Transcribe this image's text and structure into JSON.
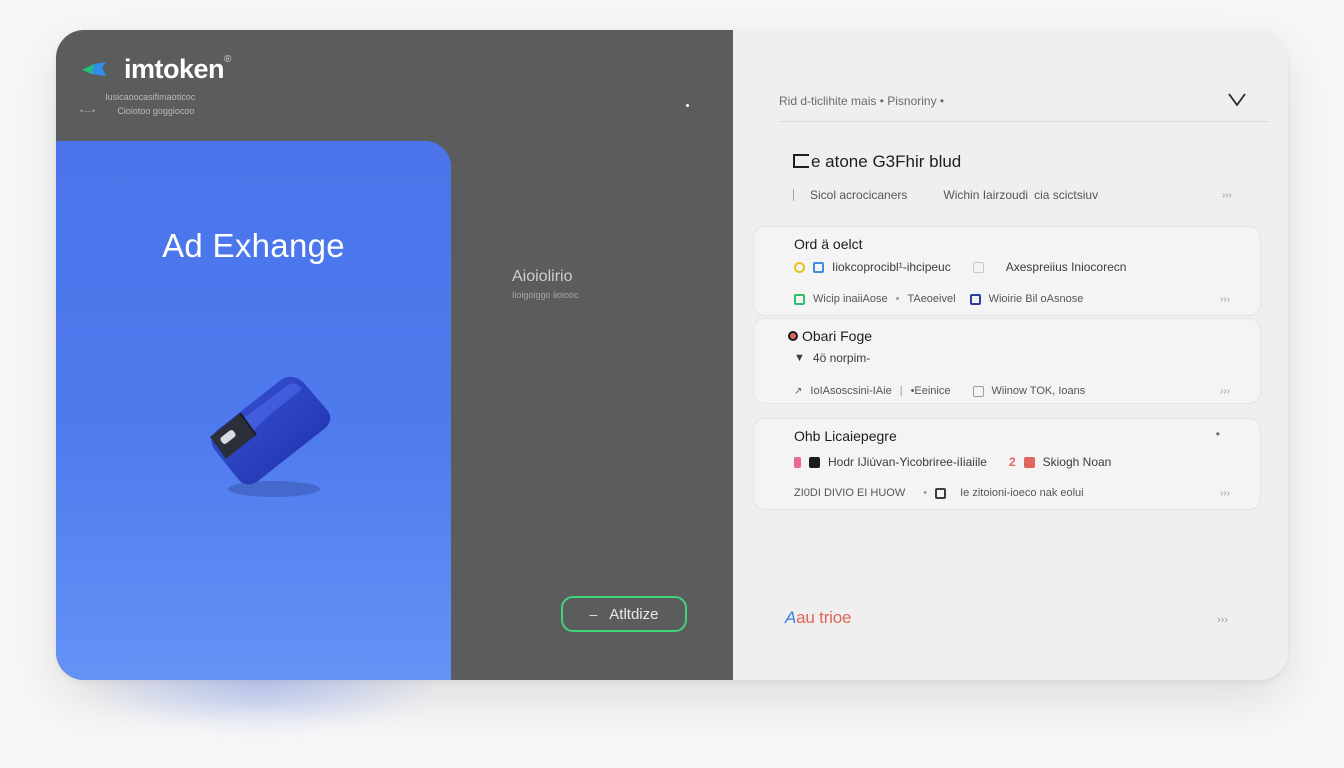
{
  "brand": {
    "name": "imtoken",
    "mark": "®",
    "sub_line1": "Iusicaoocasifimaoticoc",
    "sub_line1_prefix": "•",
    "sub_line2_prefix": "•—•",
    "sub_line2": "Cioiotoo goggiocoo"
  },
  "hero": {
    "title": "Ad Exhange"
  },
  "side": {
    "label": "Aioiolirio",
    "sub": "Iioigoiggo iioiooc"
  },
  "action_button": {
    "label": "Atltdize",
    "prefix": "–"
  },
  "topbar": {
    "text": "Rid d-ticlihite mais • Pisnoriny •"
  },
  "section": {
    "title": "e atone G3Fhir blud",
    "meta_left": "Sicol acrocicaners",
    "meta_mid": "Wichin Iairzoudi",
    "meta_right": "cia scictsiuv",
    "meta_end": "›››"
  },
  "items": [
    {
      "title": "Ord ä oelct",
      "row1": [
        "Iiokcoprocibl¹-ihcipeuc",
        "Axespreiius Iniocorecn"
      ],
      "row2": [
        "Wicip inaiiAose",
        "•",
        "TAeoeivel",
        "Wioirie Bil oAsnose"
      ],
      "end": "›››"
    },
    {
      "title": "Obari Foge",
      "row1": [
        "4ö norpim-"
      ],
      "row2": [
        "IoIAsoscsini-IAie",
        "|",
        "•Eeinice",
        "Wiinow TOK, Ioans"
      ],
      "end": "›››"
    },
    {
      "title": "Ohb Licaiepegre",
      "row1": [
        "Hodr IJiúvan-Yicobriree-iIiaiile",
        "2",
        "Skiogh Noan"
      ],
      "row2": [
        "ZI0DI DIVIO EI HUOW",
        "•",
        "Ie zitoioni-ioeco nak eolui"
      ],
      "end": "›››",
      "top_end": "•"
    }
  ],
  "bottom": {
    "link_prefix": "A",
    "link_rest": "au trioe",
    "arrow": "›››"
  },
  "colors": {
    "left_panel": "#5b5c5e",
    "hero_blue": "#4f7bee",
    "button_border": "#3fd67a",
    "right_panel": "#efeff0",
    "accent_red": "#e0655a"
  }
}
